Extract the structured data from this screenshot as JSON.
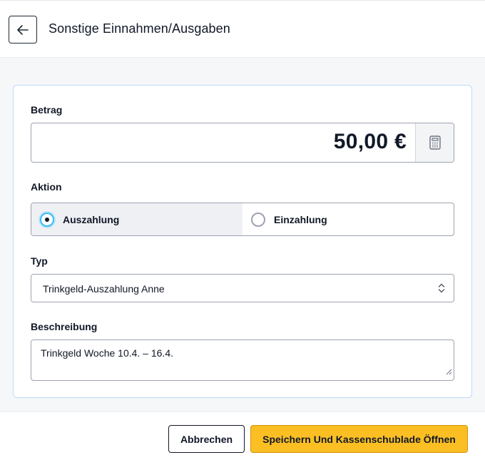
{
  "header": {
    "title": "Sonstige Einnahmen/Ausgaben",
    "back_icon": "arrow-left-icon"
  },
  "form": {
    "amount": {
      "label": "Betrag",
      "value": "50,00 €",
      "calculator_icon": "calculator-icon"
    },
    "action": {
      "label": "Aktion",
      "options": [
        {
          "label": "Auszahlung",
          "selected": true
        },
        {
          "label": "Einzahlung",
          "selected": false
        }
      ]
    },
    "type": {
      "label": "Typ",
      "value": "Trinkgeld-Auszahlung Anne"
    },
    "description": {
      "label": "Beschreibung",
      "value": "Trinkgeld Woche 10.4. – 16.4."
    }
  },
  "footer": {
    "cancel_label": "Abbrechen",
    "save_label": "Speichern Und Kassenschublade Öffnen"
  },
  "colors": {
    "accent": "#fbbf24",
    "radio_selected": "#38bdf8",
    "card_border": "#bfdbfe"
  }
}
